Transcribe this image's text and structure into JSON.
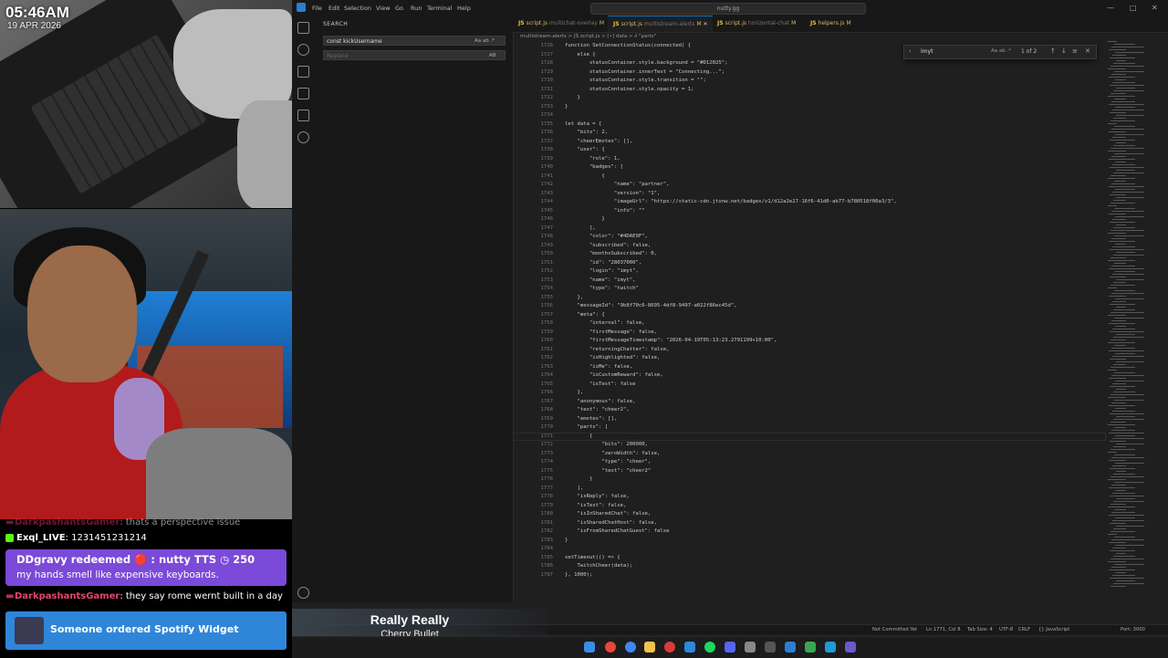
{
  "overlay": {
    "clock": "05:46AM",
    "date": "19 APR 2026"
  },
  "chat": {
    "line1": {
      "user": "DarkpashantsGamer",
      "text": ": thats a perspective issue"
    },
    "line2": {
      "user": "Exql_LIVE",
      "text": ": 1231451231214"
    },
    "redeem": {
      "title": "DDgravy redeemed 🔴 : nutty TTS ◷ 250",
      "message": "my hands smell like expensive keyboards."
    },
    "line3": {
      "user": "DarkpashantsGamer",
      "text": ": they say rome wernt built in a day"
    },
    "spotify": "Someone ordered Spotify Widget"
  },
  "now_playing": {
    "song": "Really Really",
    "artist": "Cherry Bullet"
  },
  "vscode": {
    "menu": [
      "File",
      "Edit",
      "Selection",
      "View",
      "Go",
      "Run",
      "Terminal",
      "Help"
    ],
    "command_center": "nutty.gg",
    "sidebar": {
      "title": "SEARCH",
      "search_value": "const kickUsername",
      "replace_placeholder": "Replace",
      "case_flags": "Aa ab .*",
      "replace_flag": "AB"
    },
    "tabs": [
      {
        "name": "script.js",
        "path": "multichat-overlay",
        "mark": "M"
      },
      {
        "name": "script.js",
        "path": "multistream-alerts",
        "mark": "M"
      },
      {
        "name": "script.js",
        "path": "horizontal-chat",
        "mark": "M"
      },
      {
        "name": "helpers.js",
        "path": "",
        "mark": "M"
      }
    ],
    "breadcrumb": "multistream-alerts > JS script.js > [∙] data > ∂ \"parts\"",
    "find": {
      "value": "imyt",
      "result": "1 of 2",
      "options": "Aa ab .*"
    },
    "lines": [
      {
        "n": "1726",
        "t": "function SetConnectionStatus(connected) {"
      },
      {
        "n": "1727",
        "t": "    else {"
      },
      {
        "n": "1728",
        "t": "        statusContainer.style.background = \"#D12025\";"
      },
      {
        "n": "1729",
        "t": "        statusContainer.innerText = \"Connecting...\";"
      },
      {
        "n": "1730",
        "t": "        statusContainer.style.transition = \"\";"
      },
      {
        "n": "1731",
        "t": "        statusContainer.style.opacity = 1;"
      },
      {
        "n": "1732",
        "t": "    }"
      },
      {
        "n": "1733",
        "t": "}"
      },
      {
        "n": "1734",
        "t": ""
      },
      {
        "n": "1735",
        "t": "let data = {"
      },
      {
        "n": "1736",
        "t": "    \"bits\": 2,"
      },
      {
        "n": "1737",
        "t": "    \"cheerEmotes\": [],"
      },
      {
        "n": "1738",
        "t": "    \"user\": {"
      },
      {
        "n": "1739",
        "t": "        \"role\": 1,"
      },
      {
        "n": "1740",
        "t": "        \"badges\": ["
      },
      {
        "n": "1741",
        "t": "            {"
      },
      {
        "n": "1742",
        "t": "                \"name\": \"partner\","
      },
      {
        "n": "1743",
        "t": "                \"version\": \"1\","
      },
      {
        "n": "1744",
        "t": "                \"imageUrl\": \"https://static-cdn.jtvnw.net/badges/v1/d12a2e27-16f6-41d0-ab77-b780518f00a3/3\","
      },
      {
        "n": "1745",
        "t": "                \"info\": \"\""
      },
      {
        "n": "1746",
        "t": "            }"
      },
      {
        "n": "1747",
        "t": "        ],"
      },
      {
        "n": "1748",
        "t": "        \"color\": \"#4DAE9F\","
      },
      {
        "n": "1749",
        "t": "        \"subscribed\": false,"
      },
      {
        "n": "1750",
        "t": "        \"monthsSubscribed\": 0,"
      },
      {
        "n": "1751",
        "t": "        \"id\": \"28037000\","
      },
      {
        "n": "1752",
        "t": "        \"login\": \"imyt\","
      },
      {
        "n": "1753",
        "t": "        \"name\": \"imyt\","
      },
      {
        "n": "1754",
        "t": "        \"type\": \"twitch\""
      },
      {
        "n": "1755",
        "t": "    },"
      },
      {
        "n": "1756",
        "t": "    \"messageId\": \"9b8f70c6-8695-4df8-9497-a022f86ec45d\","
      },
      {
        "n": "1757",
        "t": "    \"meta\": {"
      },
      {
        "n": "1758",
        "t": "        \"internal\": false,"
      },
      {
        "n": "1759",
        "t": "        \"firstMessage\": false,"
      },
      {
        "n": "1760",
        "t": "        \"firstMessageTimestamp\": \"2026-04-19T05:13:23.2791199+10:00\","
      },
      {
        "n": "1761",
        "t": "        \"returningChatter\": false,"
      },
      {
        "n": "1762",
        "t": "        \"isHighlighted\": false,"
      },
      {
        "n": "1763",
        "t": "        \"isMe\": false,"
      },
      {
        "n": "1764",
        "t": "        \"isCustomReward\": false,"
      },
      {
        "n": "1765",
        "t": "        \"isTest\": false"
      },
      {
        "n": "1766",
        "t": "    },"
      },
      {
        "n": "1767",
        "t": "    \"anonymous\": false,"
      },
      {
        "n": "1768",
        "t": "    \"text\": \"cheer2\","
      },
      {
        "n": "1769",
        "t": "    \"emotes\": [],"
      },
      {
        "n": "1770",
        "t": "    \"parts\": ["
      },
      {
        "n": "1771",
        "t": "        {"
      },
      {
        "n": "1772",
        "t": "            \"bits\": 200000,"
      },
      {
        "n": "1773",
        "t": "            \"zeroWidth\": false,"
      },
      {
        "n": "1774",
        "t": "            \"type\": \"cheer\","
      },
      {
        "n": "1775",
        "t": "            \"text\": \"cheer2\""
      },
      {
        "n": "1776",
        "t": "        }"
      },
      {
        "n": "1777",
        "t": "    ],"
      },
      {
        "n": "1778",
        "t": "    \"isReply\": false,"
      },
      {
        "n": "1779",
        "t": "    \"isTest\": false,"
      },
      {
        "n": "1780",
        "t": "    \"isInSharedChat\": false,"
      },
      {
        "n": "1781",
        "t": "    \"isSharedChatHost\": false,"
      },
      {
        "n": "1782",
        "t": "    \"isFromSharedChatGuest\": false"
      },
      {
        "n": "1783",
        "t": "}"
      },
      {
        "n": "1784",
        "t": ""
      },
      {
        "n": "1785",
        "t": "setTimeout(() => {"
      },
      {
        "n": "1786",
        "t": "    TwitchCheer(data);"
      },
      {
        "n": "1787",
        "t": "}, 1000);"
      }
    ],
    "status": {
      "git": "Not Committed Yet",
      "position": "Ln 1771, Col 8",
      "tab": "Tab Size: 4",
      "encoding": "UTF-8",
      "eol": "CRLF",
      "lang": "{} JavaScript",
      "port": "Port: 3000"
    }
  },
  "colors": {
    "accent": "#0078d4",
    "redeem": "#7b4ad8",
    "spotify": "#2f86d9",
    "chat_nick": "#c8285a"
  }
}
